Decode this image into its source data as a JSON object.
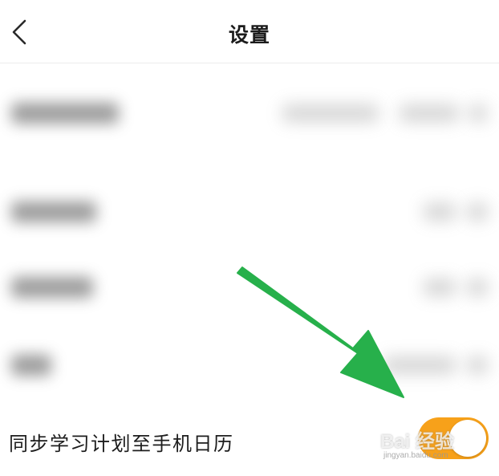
{
  "header": {
    "title": "设置",
    "back_icon": "chevron-left-icon"
  },
  "settings": {
    "sync_label": "同步学习计划至手机日历",
    "sync_enabled": true
  },
  "colors": {
    "toggle_on": "#f7a11a",
    "arrow": "#27b04b"
  },
  "watermark": {
    "main": "Bai 经验",
    "sub": "jingyan.baidu.com"
  }
}
